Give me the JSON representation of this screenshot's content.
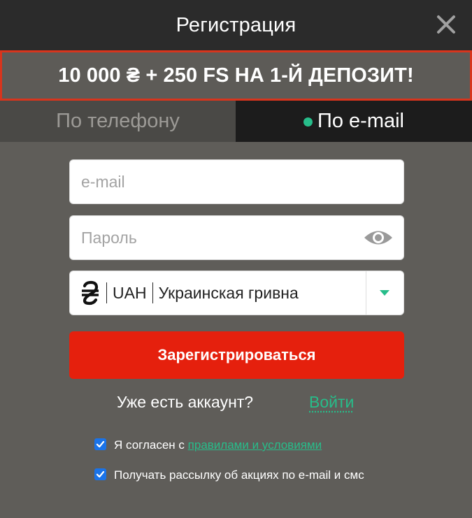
{
  "header": {
    "title": "Регистрация"
  },
  "promo": {
    "text": "10 000 ₴ + 250 FS НА 1-Й ДЕПОЗИТ!"
  },
  "tabs": [
    {
      "label": "По телефону",
      "active": false
    },
    {
      "label": "По e-mail",
      "active": true
    }
  ],
  "form": {
    "email_placeholder": "e-mail",
    "password_placeholder": "Пароль",
    "currency": {
      "code": "UAH",
      "name": "Украинская гривна",
      "symbol": "₴"
    },
    "submit_label": "Зарегистрироваться"
  },
  "login": {
    "question": "Уже есть аккаунт?",
    "link_label": "Войти"
  },
  "agreements": {
    "terms_prefix": "Я согласен с",
    "terms_link": "правилами и условиями",
    "newsletter": "Получать рассылку об акциях по e-mail и смс",
    "terms_checked": true,
    "newsletter_checked": true
  },
  "icons": {
    "close": "close-icon",
    "eye": "eye-icon",
    "caret": "chevron-down-icon",
    "check": "check-icon"
  },
  "colors": {
    "header_bg": "#2b2b2b",
    "body_bg": "#5f5d59",
    "promo_border": "#d8351d",
    "submit_bg": "#e5200d",
    "accent_green": "#27bd8a",
    "checkbox_blue": "#1a73e8"
  }
}
